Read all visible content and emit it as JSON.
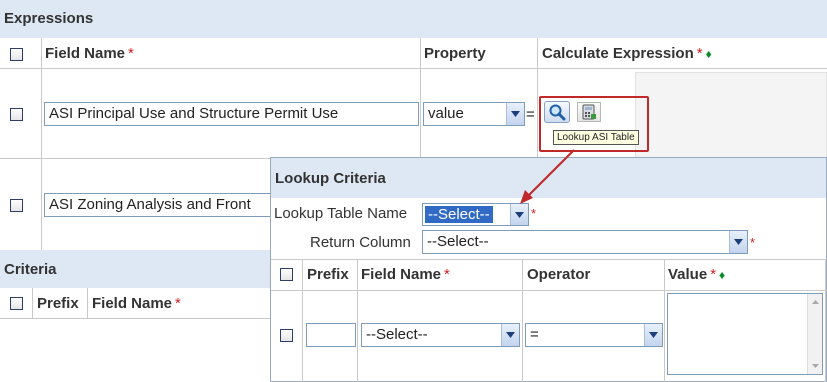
{
  "expressions": {
    "title": "Expressions",
    "columns": {
      "field_name": "Field Name",
      "property": "Property",
      "calc": "Calculate Expression"
    },
    "required_mark": "*",
    "diamond": "♦",
    "rows": [
      {
        "field": "ASI Principal Use and Structure Permit  Use",
        "property": "value",
        "equals": "="
      },
      {
        "field": "ASI Zoning Analysis and Front"
      }
    ],
    "tooltip": "Lookup ASI Table"
  },
  "criteria": {
    "title": "Criteria",
    "columns": {
      "prefix": "Prefix",
      "field_name": "Field Name"
    }
  },
  "lookup": {
    "title": "Lookup Criteria",
    "table_label": "Lookup Table Name",
    "table_value": "--Select--",
    "return_label": "Return Column",
    "return_value": "--Select--",
    "columns": {
      "prefix": "Prefix",
      "field_name": "Field Name",
      "operator": "Operator",
      "value": "Value"
    },
    "row": {
      "field_value": "--Select--",
      "operator_value": "="
    }
  },
  "icons": {
    "lookup": "magnifier-icon",
    "calculator": "calculator-icon",
    "arrow": "callout-arrow",
    "dropdown": "chevron-down-icon"
  },
  "colors": {
    "header_bar": "#dde8f4",
    "required": "#d02020",
    "diamond": "#0a8a2a",
    "callout": "#c0282a",
    "select_highlight": "#316ac5"
  }
}
